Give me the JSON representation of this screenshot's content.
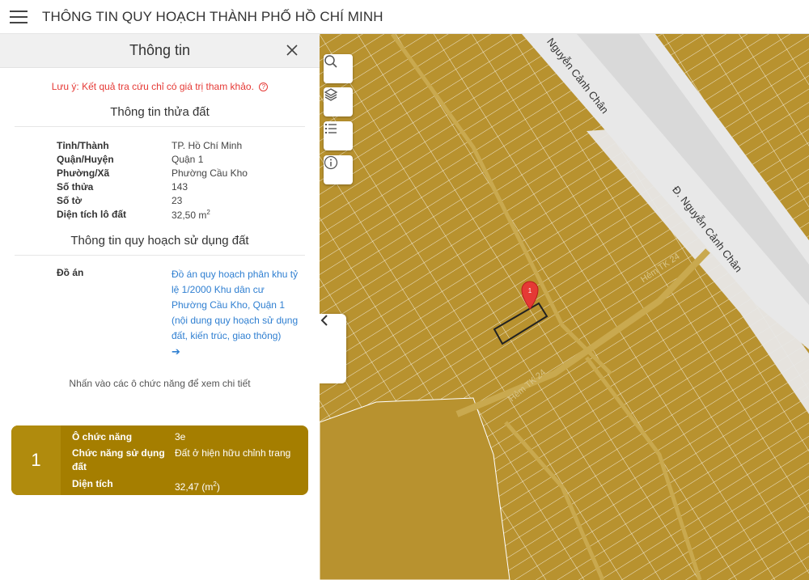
{
  "header": {
    "title": "THÔNG TIN QUY HOẠCH THÀNH PHỐ HỒ CHÍ MINH",
    "menu_icon": "hamburger-icon"
  },
  "panel": {
    "title": "Thông tin",
    "note": "Lưu ý: Kết quả tra cứu chỉ có giá trị tham khảo.",
    "note_help": "?",
    "land_section": {
      "title": "Thông tin thửa đất",
      "rows": [
        {
          "label": "Tỉnh/Thành",
          "value": "TP. Hồ Chí Minh"
        },
        {
          "label": "Quận/Huyện",
          "value": "Quận 1"
        },
        {
          "label": "Phường/Xã",
          "value": "Phường Cầu Kho"
        },
        {
          "label": "Số thửa",
          "value": "143"
        },
        {
          "label": "Số tờ",
          "value": "23"
        },
        {
          "label": "Diện tích lô đất",
          "value": "32,50 m",
          "unit_sup": "2"
        }
      ]
    },
    "plan_section": {
      "title": "Thông tin quy hoạch sử dụng đất",
      "plan_label": "Đồ án",
      "plan_link": "Đồ án quy hoạch phân khu tỷ lệ 1/2000 Khu dân cư Phường Cầu Kho, Quận 1 (nội dung quy hoạch sử dụng đất, kiến trúc, giao thông)",
      "plan_arrow": "➔"
    },
    "hint": "Nhấn vào các ô chức năng để xem chi tiết",
    "function_card": {
      "index": "1",
      "cell_label": "Ô chức năng",
      "cell_value": "3e",
      "use_label": "Chức năng sử dụng đất",
      "use_value": "Đất ở hiện hữu chỉnh trang",
      "area_label": "Diện tích",
      "area_value": "32,47 (m",
      "area_sup": "2",
      "area_suffix": ")",
      "color": "#a57e00"
    }
  },
  "map": {
    "tools": [
      "search-icon",
      "layers-icon",
      "list-icon",
      "info-icon"
    ],
    "collapse_icon": "chevron-left-icon",
    "marker_label": "1",
    "streets": [
      "Nguyễn Cảnh Chân",
      "Đ. Nguyễn Cảnh Chân"
    ],
    "alleys": [
      "Hẻm TK 24"
    ],
    "colors": {
      "land": "#b8922f",
      "road": "#e8e8e8",
      "parcel_line": "#ffffff",
      "marker": "#e53935"
    }
  }
}
